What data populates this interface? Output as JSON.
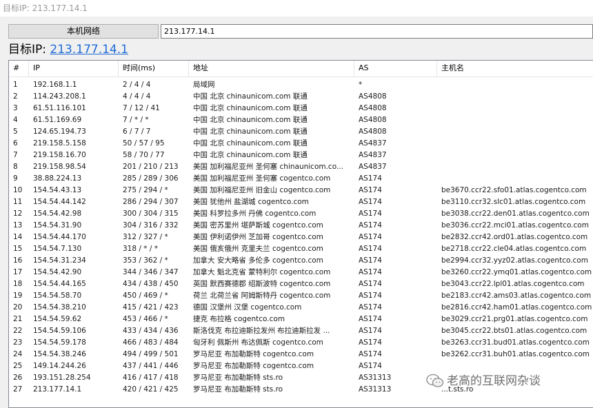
{
  "window": {
    "title": "目标IP: 213.177.14.1"
  },
  "toolbar": {
    "local_network_label": "本机网络",
    "ip_value": "213.177.14.1"
  },
  "target": {
    "label": "目标IP: ",
    "ip": "213.177.14.1"
  },
  "table": {
    "headers": [
      "#",
      "IP",
      "时间(ms)",
      "地址",
      "AS",
      "主机名"
    ],
    "rows": [
      [
        "1",
        "192.168.1.1",
        "2 / 4 / 4",
        "局域网",
        "*",
        ""
      ],
      [
        "2",
        "114.243.208.1",
        "4 / 4 / 4",
        "中国 北京 chinaunicom.com 联通",
        "AS4808",
        ""
      ],
      [
        "3",
        "61.51.116.101",
        "7 / 12 / 41",
        "中国 北京 chinaunicom.com 联通",
        "AS4808",
        ""
      ],
      [
        "4",
        "61.51.169.69",
        "7 / * / *",
        "中国 北京 chinaunicom.com 联通",
        "AS4808",
        ""
      ],
      [
        "5",
        "124.65.194.73",
        "6 / 7 / 7",
        "中国 北京 chinaunicom.com 联通",
        "AS4808",
        ""
      ],
      [
        "6",
        "219.158.5.158",
        "50 / 57 / 95",
        "中国 北京 chinaunicom.com 联通",
        "AS4837",
        ""
      ],
      [
        "7",
        "219.158.16.70",
        "58 / 70 / 77",
        "中国 北京 chinaunicom.com 联通",
        "AS4837",
        ""
      ],
      [
        "8",
        "219.158.98.54",
        "201 / 210 / 213",
        "美国 加利福尼亚州 圣何塞 chinaunicom.co...",
        "AS4837",
        ""
      ],
      [
        "9",
        "38.88.224.13",
        "285 / 289 / 306",
        "美国 加利福尼亚州 圣何塞 cogentco.com",
        "AS174",
        ""
      ],
      [
        "10",
        "154.54.43.13",
        "275 / 294 / *",
        "美国 加利福尼亚州 旧金山 cogentco.com",
        "AS174",
        "be3670.ccr22.sfo01.atlas.cogentco.com"
      ],
      [
        "11",
        "154.54.44.142",
        "286 / 294 / 307",
        "美国 犹他州 盐湖城 cogentco.com",
        "AS174",
        "be3110.ccr32.slc01.atlas.cogentco.com"
      ],
      [
        "12",
        "154.54.42.98",
        "300 / 304 / 315",
        "美国 科罗拉多州 丹佛 cogentco.com",
        "AS174",
        "be3038.ccr22.den01.atlas.cogentco.com"
      ],
      [
        "13",
        "154.54.31.90",
        "304 / 316 / 332",
        "美国 密苏里州 堪萨斯城 cogentco.com",
        "AS174",
        "be3036.ccr22.mci01.atlas.cogentco.com"
      ],
      [
        "14",
        "154.54.44.170",
        "312 / 327 / *",
        "美国 伊利诺伊州 芝加哥 cogentco.com",
        "AS174",
        "be2832.ccr42.ord01.atlas.cogentco.com"
      ],
      [
        "15",
        "154.54.7.130",
        "318 / * / *",
        "美国 俄亥俄州 克里夫兰 cogentco.com",
        "AS174",
        "be2718.ccr22.cle04.atlas.cogentco.com"
      ],
      [
        "16",
        "154.54.31.234",
        "353 / 362 / *",
        "加拿大 安大略省 多伦多 cogentco.com",
        "AS174",
        "be2994.ccr32.yyz02.atlas.cogentco.com"
      ],
      [
        "17",
        "154.54.42.90",
        "344 / 346 / 347",
        "加拿大 魁北克省 蒙特利尔 cogentco.com",
        "AS174",
        "be3260.ccr22.ymq01.atlas.cogentco.com"
      ],
      [
        "18",
        "154.54.44.165",
        "434 / 438 / 450",
        "英国 默西赛德郡 绍斯波特 cogentco.com",
        "AS174",
        "be3043.ccr22.lpl01.atlas.cogentco.com"
      ],
      [
        "19",
        "154.54.58.70",
        "450 / 469 / *",
        "荷兰 北荷兰省 阿姆斯特丹 cogentco.com",
        "AS174",
        "be2183.ccr42.ams03.atlas.cogentco.com"
      ],
      [
        "20",
        "154.54.38.210",
        "415 / 421 / 423",
        "德国 汉堡州 汉堡 cogentco.com",
        "AS174",
        "be2816.ccr42.ham01.atlas.cogentco.com"
      ],
      [
        "21",
        "154.54.59.62",
        "453 / 466 / *",
        "捷克 布拉格 cogentco.com",
        "AS174",
        "be3029.ccr21.prg01.atlas.cogentco.com"
      ],
      [
        "22",
        "154.54.59.106",
        "433 / 434 / 436",
        "斯洛伐克 布拉迪斯拉发州 布拉迪斯拉发 ...",
        "AS174",
        "be3045.ccr22.bts01.atlas.cogentco.com"
      ],
      [
        "23",
        "154.54.59.178",
        "466 / 483 / 484",
        "匈牙利 佩斯州 布达佩斯 cogentco.com",
        "AS174",
        "be3263.ccr31.bud01.atlas.cogentco.com"
      ],
      [
        "24",
        "154.54.38.246",
        "494 / 499 / 501",
        "罗马尼亚 布加勒斯特 cogentco.com",
        "AS174",
        "be3262.ccr31.buh01.atlas.cogentco.com"
      ],
      [
        "25",
        "149.14.244.26",
        "437 / 441 / 446",
        "罗马尼亚 布加勒斯特 cogentco.com",
        "AS174",
        ""
      ],
      [
        "26",
        "193.151.28.254",
        "416 / 417 / 418",
        "罗马尼亚 布加勒斯特 sts.ro",
        "AS31313",
        ""
      ],
      [
        "27",
        "213.177.14.1",
        "420 / 421 / 425",
        "罗马尼亚 布加勒斯特 sts.ro",
        "AS31313",
        "...t.sts.ro"
      ]
    ]
  },
  "watermark": {
    "text": "老高的互联网杂谈",
    "icon": "wechat-icon"
  }
}
